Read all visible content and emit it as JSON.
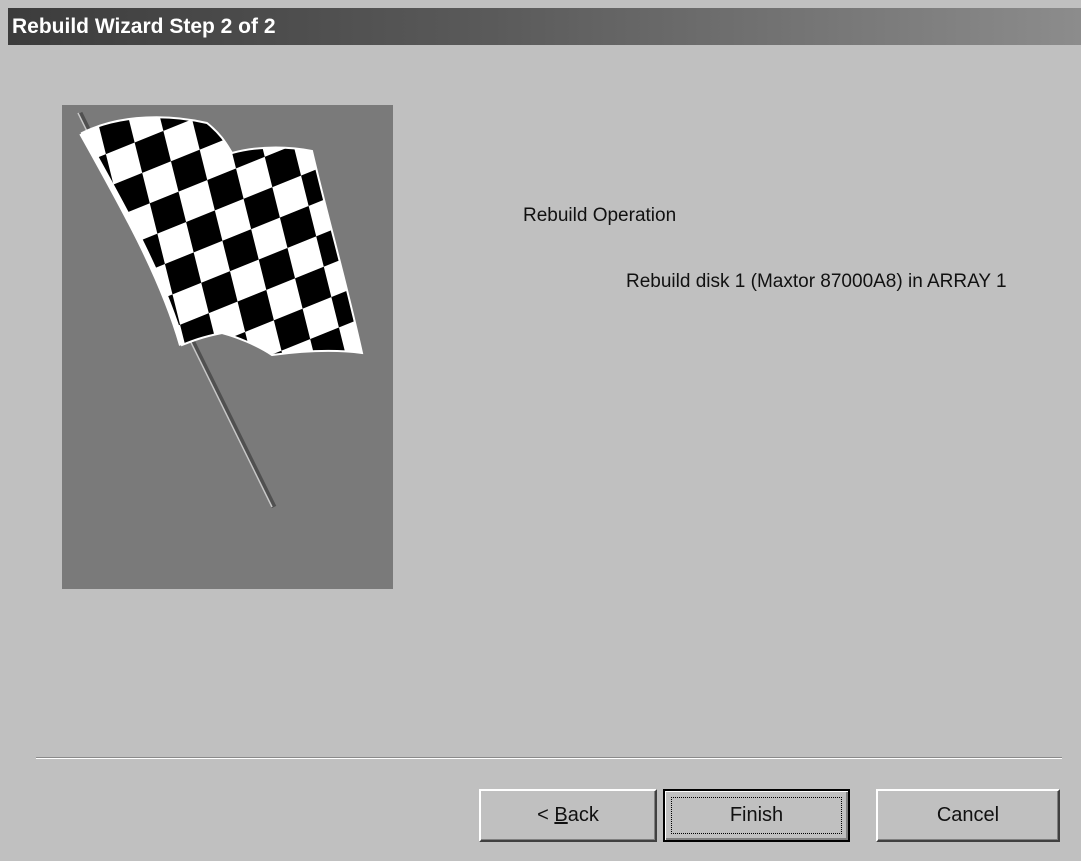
{
  "window": {
    "title": "Rebuild Wizard Step 2 of 2"
  },
  "content": {
    "heading": "Rebuild Operation",
    "description": "Rebuild disk 1 (Maxtor 87000A8) in ARRAY 1"
  },
  "buttons": {
    "back_prefix": "< ",
    "back_mnemonic": "B",
    "back_rest": "ack",
    "finish": "Finish",
    "cancel": "Cancel"
  },
  "colors": {
    "dialog_bg": "#c0c0c0",
    "image_bg": "#7a7a7a",
    "title_text": "#ffffff"
  },
  "image": {
    "icon": "checkered-flag-icon"
  }
}
